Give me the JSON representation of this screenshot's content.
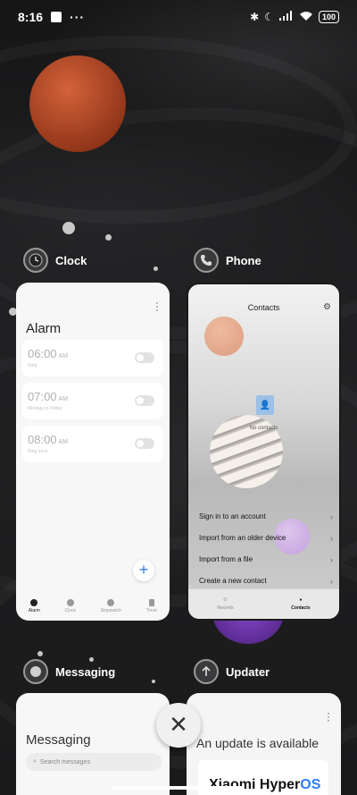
{
  "status_bar": {
    "time": "8:16",
    "more": "···",
    "battery": "100",
    "icons": [
      "bluetooth-icon",
      "moon-icon",
      "signal-icon",
      "wifi-icon",
      "battery-icon"
    ]
  },
  "apps": {
    "clock": {
      "name": "Clock",
      "screen_title": "Alarm",
      "alarms": [
        {
          "time": "06:00",
          "ampm": "AM",
          "sub": "Daily"
        },
        {
          "time": "07:00",
          "ampm": "AM",
          "sub": "Monday to Friday"
        },
        {
          "time": "08:00",
          "ampm": "AM",
          "sub": "Ring once"
        }
      ],
      "add": "+",
      "tabs": [
        "Alarm",
        "Clock",
        "Stopwatch",
        "Timer"
      ]
    },
    "phone": {
      "name": "Phone",
      "screen_title": "Contacts",
      "empty": "No contacts",
      "actions": [
        "Sign in to an account",
        "Import from an older device",
        "Import from a file",
        "Create a new contact"
      ],
      "tabs": [
        "Recents",
        "Contacts"
      ]
    },
    "messaging": {
      "name": "Messaging",
      "screen_title": "Messaging",
      "search_placeholder": "Search messages"
    },
    "updater": {
      "name": "Updater",
      "screen_title": "An update is available",
      "brand": "Xiaomi Hyper",
      "brand_os": "OS"
    }
  },
  "close_label": "✕",
  "colors": {
    "accent": "#2d7cf6",
    "planet": "#c0502a"
  }
}
